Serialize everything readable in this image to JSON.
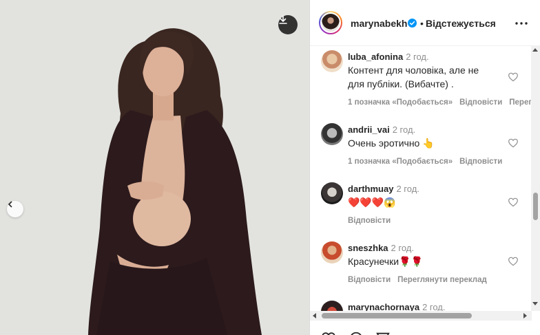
{
  "post": {
    "username": "marynabekh",
    "follow_label": "Відстежується",
    "separator": "•"
  },
  "comments": [
    {
      "username": "luba_afonina",
      "time": "2 год.",
      "lines": [
        "Контент для чоловіка, але не",
        "для публіки. (Вибачте) ."
      ],
      "likes": "1 позначка «Подобається»",
      "reply": "Відповісти",
      "translate": "Перег"
    },
    {
      "username": "andrii_vai",
      "time": "2 год.",
      "lines": [
        "Очень эротично 👆"
      ],
      "likes": "1 позначка «Подобається»",
      "reply": "Відповісти"
    },
    {
      "username": "darthmuay",
      "time": "2 год.",
      "lines": [
        "❤️❤️❤️😱"
      ],
      "reply": "Відповісти"
    },
    {
      "username": "sneszhka",
      "time": "2 год.",
      "lines": [
        "Красунечки🌹🌹"
      ],
      "reply": "Відповісти",
      "translate": "Переглянути переклад"
    },
    {
      "username": "marynachornaya",
      "time": "2 год."
    }
  ],
  "icons": {
    "download": "download-icon",
    "prev": "chevron-left-icon",
    "verified": "verified-badge-icon",
    "more": "more-options-icon",
    "heart": "heart-icon",
    "comment": "comment-icon",
    "share": "share-icon"
  },
  "colors": {
    "verified": "#0095f6",
    "text": "#262626",
    "muted": "#8e8e8e"
  }
}
